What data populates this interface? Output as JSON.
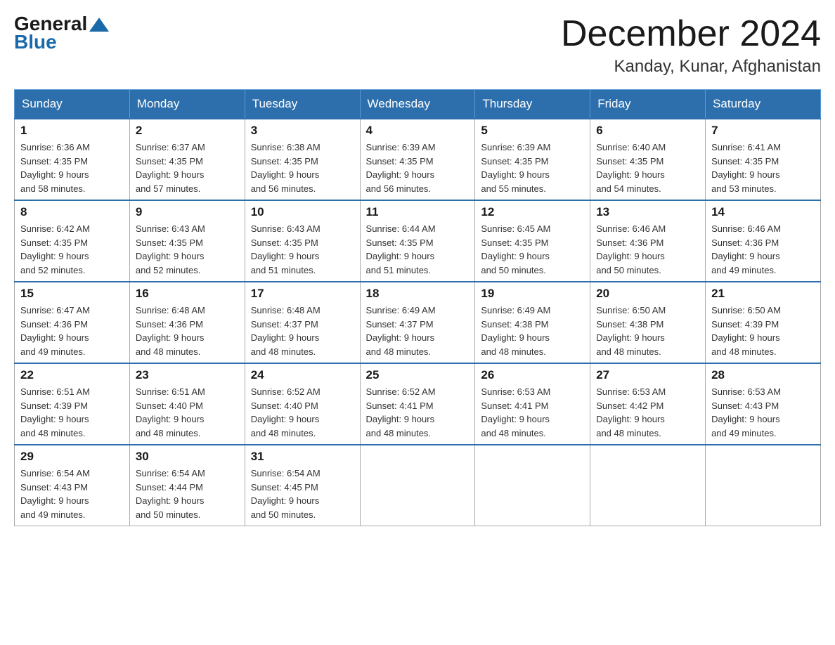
{
  "header": {
    "logo_general": "General",
    "logo_blue": "Blue",
    "month_title": "December 2024",
    "location": "Kanday, Kunar, Afghanistan"
  },
  "weekdays": [
    "Sunday",
    "Monday",
    "Tuesday",
    "Wednesday",
    "Thursday",
    "Friday",
    "Saturday"
  ],
  "weeks": [
    [
      {
        "day": "1",
        "sunrise": "6:36 AM",
        "sunset": "4:35 PM",
        "daylight": "9 hours and 58 minutes."
      },
      {
        "day": "2",
        "sunrise": "6:37 AM",
        "sunset": "4:35 PM",
        "daylight": "9 hours and 57 minutes."
      },
      {
        "day": "3",
        "sunrise": "6:38 AM",
        "sunset": "4:35 PM",
        "daylight": "9 hours and 56 minutes."
      },
      {
        "day": "4",
        "sunrise": "6:39 AM",
        "sunset": "4:35 PM",
        "daylight": "9 hours and 56 minutes."
      },
      {
        "day": "5",
        "sunrise": "6:39 AM",
        "sunset": "4:35 PM",
        "daylight": "9 hours and 55 minutes."
      },
      {
        "day": "6",
        "sunrise": "6:40 AM",
        "sunset": "4:35 PM",
        "daylight": "9 hours and 54 minutes."
      },
      {
        "day": "7",
        "sunrise": "6:41 AM",
        "sunset": "4:35 PM",
        "daylight": "9 hours and 53 minutes."
      }
    ],
    [
      {
        "day": "8",
        "sunrise": "6:42 AM",
        "sunset": "4:35 PM",
        "daylight": "9 hours and 52 minutes."
      },
      {
        "day": "9",
        "sunrise": "6:43 AM",
        "sunset": "4:35 PM",
        "daylight": "9 hours and 52 minutes."
      },
      {
        "day": "10",
        "sunrise": "6:43 AM",
        "sunset": "4:35 PM",
        "daylight": "9 hours and 51 minutes."
      },
      {
        "day": "11",
        "sunrise": "6:44 AM",
        "sunset": "4:35 PM",
        "daylight": "9 hours and 51 minutes."
      },
      {
        "day": "12",
        "sunrise": "6:45 AM",
        "sunset": "4:35 PM",
        "daylight": "9 hours and 50 minutes."
      },
      {
        "day": "13",
        "sunrise": "6:46 AM",
        "sunset": "4:36 PM",
        "daylight": "9 hours and 50 minutes."
      },
      {
        "day": "14",
        "sunrise": "6:46 AM",
        "sunset": "4:36 PM",
        "daylight": "9 hours and 49 minutes."
      }
    ],
    [
      {
        "day": "15",
        "sunrise": "6:47 AM",
        "sunset": "4:36 PM",
        "daylight": "9 hours and 49 minutes."
      },
      {
        "day": "16",
        "sunrise": "6:48 AM",
        "sunset": "4:36 PM",
        "daylight": "9 hours and 48 minutes."
      },
      {
        "day": "17",
        "sunrise": "6:48 AM",
        "sunset": "4:37 PM",
        "daylight": "9 hours and 48 minutes."
      },
      {
        "day": "18",
        "sunrise": "6:49 AM",
        "sunset": "4:37 PM",
        "daylight": "9 hours and 48 minutes."
      },
      {
        "day": "19",
        "sunrise": "6:49 AM",
        "sunset": "4:38 PM",
        "daylight": "9 hours and 48 minutes."
      },
      {
        "day": "20",
        "sunrise": "6:50 AM",
        "sunset": "4:38 PM",
        "daylight": "9 hours and 48 minutes."
      },
      {
        "day": "21",
        "sunrise": "6:50 AM",
        "sunset": "4:39 PM",
        "daylight": "9 hours and 48 minutes."
      }
    ],
    [
      {
        "day": "22",
        "sunrise": "6:51 AM",
        "sunset": "4:39 PM",
        "daylight": "9 hours and 48 minutes."
      },
      {
        "day": "23",
        "sunrise": "6:51 AM",
        "sunset": "4:40 PM",
        "daylight": "9 hours and 48 minutes."
      },
      {
        "day": "24",
        "sunrise": "6:52 AM",
        "sunset": "4:40 PM",
        "daylight": "9 hours and 48 minutes."
      },
      {
        "day": "25",
        "sunrise": "6:52 AM",
        "sunset": "4:41 PM",
        "daylight": "9 hours and 48 minutes."
      },
      {
        "day": "26",
        "sunrise": "6:53 AM",
        "sunset": "4:41 PM",
        "daylight": "9 hours and 48 minutes."
      },
      {
        "day": "27",
        "sunrise": "6:53 AM",
        "sunset": "4:42 PM",
        "daylight": "9 hours and 48 minutes."
      },
      {
        "day": "28",
        "sunrise": "6:53 AM",
        "sunset": "4:43 PM",
        "daylight": "9 hours and 49 minutes."
      }
    ],
    [
      {
        "day": "29",
        "sunrise": "6:54 AM",
        "sunset": "4:43 PM",
        "daylight": "9 hours and 49 minutes."
      },
      {
        "day": "30",
        "sunrise": "6:54 AM",
        "sunset": "4:44 PM",
        "daylight": "9 hours and 50 minutes."
      },
      {
        "day": "31",
        "sunrise": "6:54 AM",
        "sunset": "4:45 PM",
        "daylight": "9 hours and 50 minutes."
      },
      null,
      null,
      null,
      null
    ]
  ]
}
